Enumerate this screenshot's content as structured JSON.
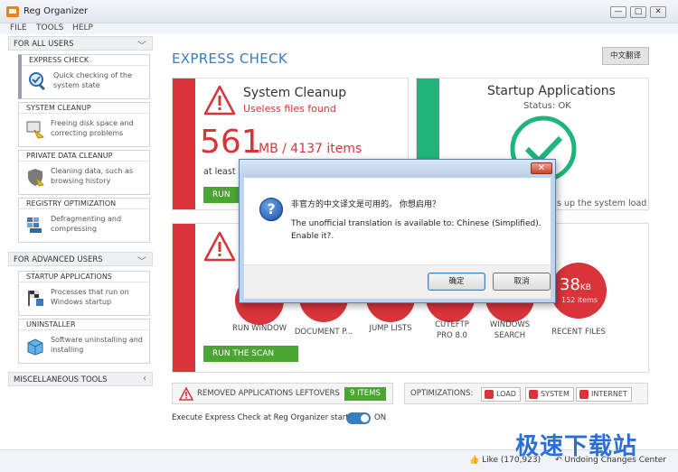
{
  "window": {
    "title": "Reg Organizer",
    "minimize": "—",
    "maximize": "□",
    "close": "✕"
  },
  "menu": [
    "FILE",
    "TOOLS",
    "HELP"
  ],
  "sidebar": {
    "section_all_users": "FOR ALL USERS",
    "section_advanced": "FOR ADVANCED USERS",
    "section_misc": "MISCELLANEOUS TOOLS",
    "items": [
      {
        "title": "EXPRESS CHECK",
        "desc": "Quick checking of the system state",
        "icon": "magnifier-check-icon"
      },
      {
        "title": "SYSTEM CLEANUP",
        "desc": "Freeing disk space and correcting problems",
        "icon": "broom-cleanup-icon"
      },
      {
        "title": "PRIVATE DATA CLEANUP",
        "desc": "Cleaning data, such as browsing history",
        "icon": "shield-brush-icon"
      },
      {
        "title": "REGISTRY OPTIMIZATION",
        "desc": "Defragmenting and compressing",
        "icon": "registry-blocks-icon"
      }
    ],
    "advanced_items": [
      {
        "title": "STARTUP APPLICATIONS",
        "desc": "Processes that run on Windows startup",
        "icon": "racing-flag-icon"
      },
      {
        "title": "UNINSTALLER",
        "desc": "Software uninstalling and installing",
        "icon": "box-install-icon"
      }
    ]
  },
  "main": {
    "title": "EXPRESS CHECK",
    "lang_button": "中文翻译",
    "cleanup": {
      "heading": "System Cleanup",
      "sub": "Useless files found",
      "size": "561",
      "unit": "MB / 4137 items",
      "note": "at least t",
      "button": "RUN"
    },
    "startup": {
      "heading": "Startup Applications",
      "status": "Status: OK",
      "note": "s up the system load"
    },
    "scan": {
      "button": "RUN THE SCAN",
      "items": [
        "RUN WINDOW",
        "DOCUMENT P...",
        "JUMP LISTS",
        "CUTEFTP PRO 8.0",
        "WINDOWS SEARCH",
        "RECENT FILES"
      ],
      "counts": [
        "",
        "",
        "",
        "",
        "",
        ""
      ],
      "big_size": "38",
      "big_unit": "KB",
      "big_items": "152 items"
    },
    "removed_label": "REMOVED APPLICATIONS LEFTOVERS",
    "removed_count": "9 ITEMS",
    "optimizations_label": "OPTIMIZATIONS:",
    "optimizations": [
      "LOAD",
      "SYSTEM",
      "INTERNET"
    ],
    "startup_check_label": "Execute Express Check at Reg Organizer startup",
    "toggle_state": "ON"
  },
  "statusbar": {
    "like": "Like (170,923)",
    "undo": "Undoing Changes Center",
    "watermark": "极速下载站"
  },
  "dialog": {
    "line_cn": "非官方的中文译文是可用的。 你想启用？",
    "line_en1": "The unofficial translation is available to: Chinese (Simplified).",
    "line_en2": "Enable it?.",
    "ok": "确定",
    "cancel": "取消",
    "close": "✕"
  },
  "colors": {
    "accent_blue": "#3a7dbf",
    "red": "#d8343a",
    "green": "#4aa532",
    "teal": "#1fb57a"
  }
}
